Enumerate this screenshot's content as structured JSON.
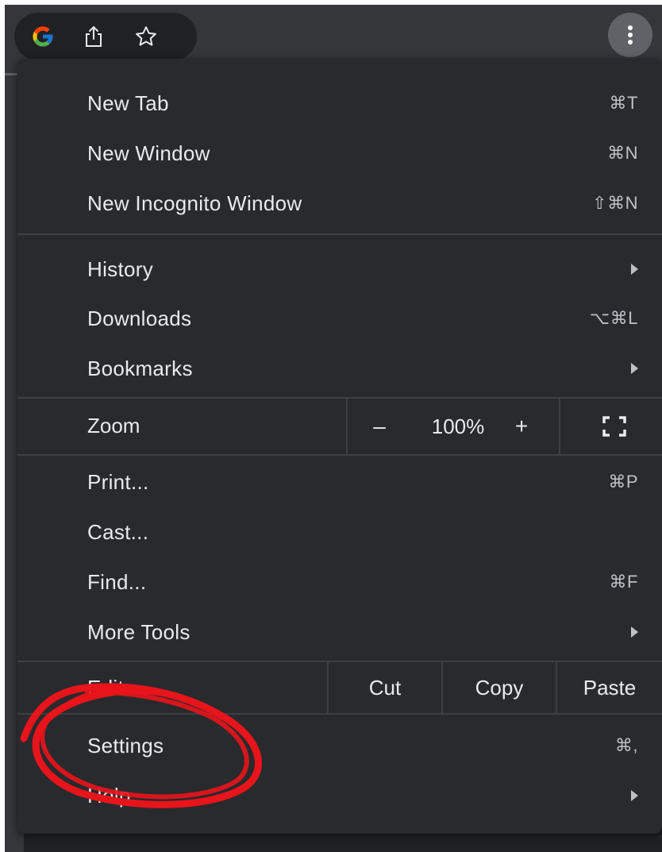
{
  "toolbar": {
    "google_icon": "google-g-icon",
    "share_icon": "share-icon",
    "bookmark_icon": "star-icon",
    "menu_icon": "kebab-menu-icon"
  },
  "menu": {
    "new_tab": {
      "label": "New Tab",
      "shortcut": "⌘T"
    },
    "new_window": {
      "label": "New Window",
      "shortcut": "⌘N"
    },
    "new_incognito": {
      "label": "New Incognito Window",
      "shortcut": "⇧⌘N"
    },
    "history": {
      "label": "History"
    },
    "downloads": {
      "label": "Downloads",
      "shortcut": "⌥⌘L"
    },
    "bookmarks": {
      "label": "Bookmarks"
    },
    "zoom": {
      "label": "Zoom",
      "minus": "–",
      "value": "100%",
      "plus": "+"
    },
    "print": {
      "label": "Print...",
      "shortcut": "⌘P"
    },
    "cast": {
      "label": "Cast..."
    },
    "find": {
      "label": "Find...",
      "shortcut": "⌘F"
    },
    "more_tools": {
      "label": "More Tools"
    },
    "edit": {
      "label": "Edit",
      "cut": "Cut",
      "copy": "Copy",
      "paste": "Paste"
    },
    "settings": {
      "label": "Settings",
      "shortcut": "⌘,"
    },
    "help": {
      "label": "Help"
    }
  },
  "colors": {
    "menu_bg": "#292a2d",
    "separator": "#3c4043",
    "text": "#e8eaed",
    "annotation": "#e8141b"
  }
}
